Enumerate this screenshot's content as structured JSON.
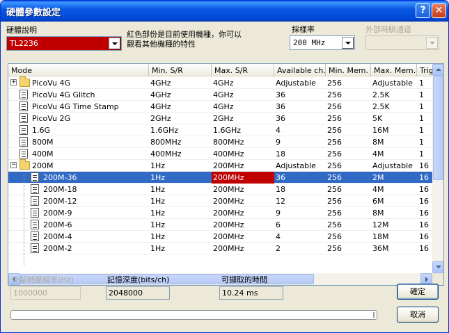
{
  "window": {
    "title": "硬體參數設定"
  },
  "device": {
    "label": "硬體說明",
    "selected": "TL2236",
    "note_line1": "紅色部份是目前使用機種，你可以",
    "note_line2": "觀看其他機種的特性"
  },
  "sample_rate": {
    "label": "採樣率",
    "selected": "200 MHz"
  },
  "ext_clock_channel": {
    "label": "外部時脈通道",
    "selected": ""
  },
  "table": {
    "columns": [
      "Mode",
      "Min. S/R",
      "Max. S/R",
      "Available ch.",
      "Min. Mem.",
      "Max. Mem.",
      "Trig"
    ],
    "rows": [
      {
        "mode": "PicoVu 4G",
        "min_sr": "4GHz",
        "max_sr": "4GHz",
        "avail": "Adjustable",
        "min_mem": "256",
        "max_mem": "Adjustable",
        "trig": "1"
      },
      {
        "mode": "PicoVu 4G Glitch",
        "min_sr": "4GHz",
        "max_sr": "4GHz",
        "avail": "36",
        "min_mem": "256",
        "max_mem": "2.5K",
        "trig": "1"
      },
      {
        "mode": "PicoVu 4G Time Stamp",
        "min_sr": "4GHz",
        "max_sr": "4GHz",
        "avail": "36",
        "min_mem": "256",
        "max_mem": "2.5K",
        "trig": "1"
      },
      {
        "mode": "PicoVu 2G",
        "min_sr": "2GHz",
        "max_sr": "2GHz",
        "avail": "36",
        "min_mem": "256",
        "max_mem": "5K",
        "trig": "1"
      },
      {
        "mode": "1.6G",
        "min_sr": "1.6GHz",
        "max_sr": "1.6GHz",
        "avail": "4",
        "min_mem": "256",
        "max_mem": "16M",
        "trig": "1"
      },
      {
        "mode": "800M",
        "min_sr": "800MHz",
        "max_sr": "800MHz",
        "avail": "9",
        "min_mem": "256",
        "max_mem": "8M",
        "trig": "1"
      },
      {
        "mode": "400M",
        "min_sr": "400MHz",
        "max_sr": "400MHz",
        "avail": "18",
        "min_mem": "256",
        "max_mem": "4M",
        "trig": "1"
      },
      {
        "mode": "200M",
        "min_sr": "1Hz",
        "max_sr": "200MHz",
        "avail": "Adjustable",
        "min_mem": "256",
        "max_mem": "Adjustable",
        "trig": "16"
      },
      {
        "mode": "200M-36",
        "min_sr": "1Hz",
        "max_sr": "200MHz",
        "avail": "36",
        "min_mem": "256",
        "max_mem": "2M",
        "trig": "16"
      },
      {
        "mode": "200M-18",
        "min_sr": "1Hz",
        "max_sr": "200MHz",
        "avail": "18",
        "min_mem": "256",
        "max_mem": "4M",
        "trig": "16"
      },
      {
        "mode": "200M-12",
        "min_sr": "1Hz",
        "max_sr": "200MHz",
        "avail": "12",
        "min_mem": "256",
        "max_mem": "6M",
        "trig": "16"
      },
      {
        "mode": "200M-9",
        "min_sr": "1Hz",
        "max_sr": "200MHz",
        "avail": "9",
        "min_mem": "256",
        "max_mem": "8M",
        "trig": "16"
      },
      {
        "mode": "200M-6",
        "min_sr": "1Hz",
        "max_sr": "200MHz",
        "avail": "6",
        "min_mem": "256",
        "max_mem": "12M",
        "trig": "16"
      },
      {
        "mode": "200M-4",
        "min_sr": "1Hz",
        "max_sr": "200MHz",
        "avail": "4",
        "min_mem": "256",
        "max_mem": "18M",
        "trig": "16"
      },
      {
        "mode": "200M-2",
        "min_sr": "1Hz",
        "max_sr": "200MHz",
        "avail": "2",
        "min_mem": "256",
        "max_mem": "36M",
        "trig": "16"
      }
    ]
  },
  "ext_clock_freq": {
    "label": "外部時脈頻率(Hz)",
    "value": "1000000"
  },
  "mem_depth": {
    "label": "記憶深度(bits/ch)",
    "value": "2048000"
  },
  "capture_time": {
    "label": "可擷取的時間",
    "value": "10.24 ms"
  },
  "buttons": {
    "ok": "確定",
    "cancel": "取消"
  },
  "colors": {
    "highlight_red": "#c00000",
    "selection_blue": "#316ac5"
  }
}
